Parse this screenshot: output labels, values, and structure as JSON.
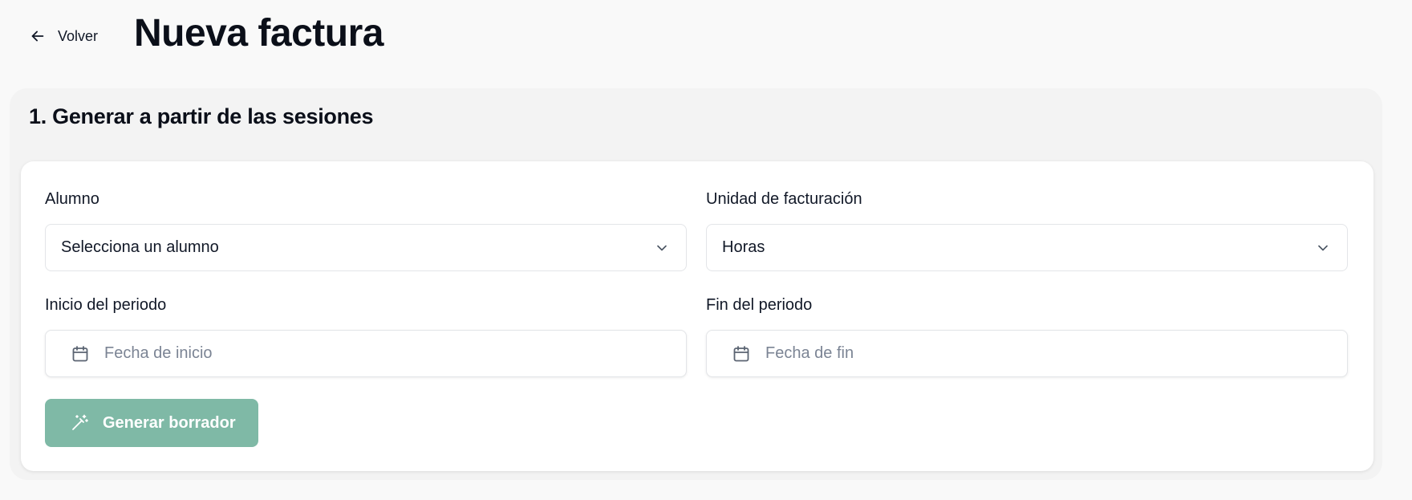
{
  "header": {
    "back_label": "Volver",
    "title": "Nueva factura"
  },
  "section": {
    "title": "1. Generar a partir de las sesiones"
  },
  "form": {
    "student": {
      "label": "Alumno",
      "value": "Selecciona un alumno"
    },
    "billing_unit": {
      "label": "Unidad de facturación",
      "value": "Horas"
    },
    "period_start": {
      "label": "Inicio del periodo",
      "placeholder": "Fecha de inicio"
    },
    "period_end": {
      "label": "Fin del periodo",
      "placeholder": "Fecha de fin"
    },
    "generate_button": "Generar borrador"
  },
  "icons": {
    "back": "arrow-left-icon",
    "dropdown": "chevron-down-icon",
    "date": "calendar-icon",
    "generate": "magic-wand-icon"
  },
  "colors": {
    "page_background": "#f9f9f9",
    "section_background": "#f3f3f3",
    "card_background": "#ffffff",
    "primary_button": "#7fb9a6",
    "placeholder_text": "#7b8494",
    "text": "#111827"
  }
}
